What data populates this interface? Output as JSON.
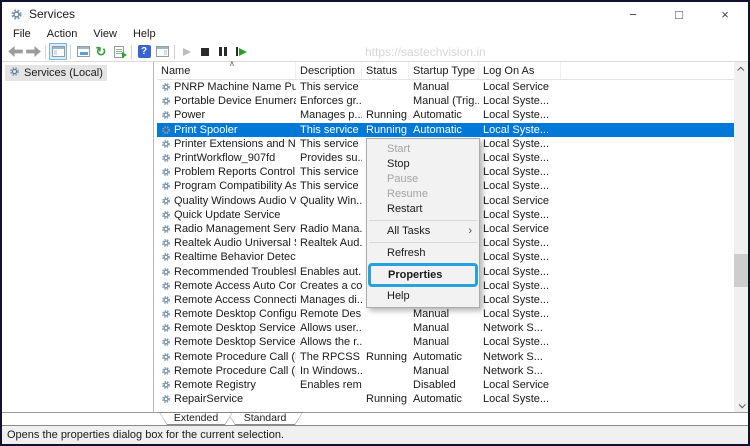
{
  "window": {
    "title": "Services",
    "controls": {
      "minimize": "−",
      "maximize": "□",
      "close": "×"
    }
  },
  "menubar": {
    "items": [
      "File",
      "Action",
      "View",
      "Help"
    ]
  },
  "toolbar": {
    "watermark": "https://sastechvision.in",
    "icons": [
      "back-icon",
      "forward-icon",
      "separator",
      "console-tree-icon",
      "separator",
      "properties-window-icon",
      "refresh-icon",
      "export-list-icon",
      "separator",
      "help-icon",
      "action-pane-icon",
      "separator",
      "start-service-icon",
      "stop-service-icon",
      "pause-service-icon",
      "restart-service-icon"
    ]
  },
  "sidebar": {
    "root_label": "Services (Local)"
  },
  "table": {
    "columns": [
      "Name",
      "Description",
      "Status",
      "Startup Type",
      "Log On As"
    ],
    "rows": [
      {
        "name": "PNRP Machine Name Publi...",
        "description": "This service ...",
        "status": "",
        "startup": "Manual",
        "logon": "Local Service",
        "selected": false
      },
      {
        "name": "Portable Device Enumerator...",
        "description": "Enforces gr...",
        "status": "",
        "startup": "Manual (Trig...",
        "logon": "Local Syste...",
        "selected": false
      },
      {
        "name": "Power",
        "description": "Manages p...",
        "status": "Running",
        "startup": "Automatic",
        "logon": "Local Syste...",
        "selected": false
      },
      {
        "name": "Print Spooler",
        "description": "This service ...",
        "status": "Running",
        "startup": "Automatic",
        "logon": "Local Syste...",
        "selected": true
      },
      {
        "name": "Printer Extensions and Notif...",
        "description": "This service ...",
        "status": "",
        "startup": "",
        "logon": "Local Syste...",
        "selected": false
      },
      {
        "name": "PrintWorkflow_907fd",
        "description": "Provides su...",
        "status": "",
        "startup": "",
        "logon": "Local Syste...",
        "selected": false
      },
      {
        "name": "Problem Reports Control Pa...",
        "description": "This service ...",
        "status": "",
        "startup": "",
        "logon": "Local Syste...",
        "selected": false
      },
      {
        "name": "Program Compatibility Assi...",
        "description": "This service ...",
        "status": "",
        "startup": "",
        "logon": "Local Syste...",
        "selected": false
      },
      {
        "name": "Quality Windows Audio Vid...",
        "description": "Quality Win...",
        "status": "",
        "startup": "",
        "logon": "Local Service",
        "selected": false
      },
      {
        "name": "Quick Update Service",
        "description": "",
        "status": "",
        "startup": "",
        "logon": "Local Syste...",
        "selected": false
      },
      {
        "name": "Radio Management Service",
        "description": "Radio Mana...",
        "status": "",
        "startup": "",
        "logon": "Local Service",
        "selected": false
      },
      {
        "name": "Realtek Audio Universal Ser...",
        "description": "Realtek Aud...",
        "status": "",
        "startup": "",
        "logon": "Local Syste...",
        "selected": false
      },
      {
        "name": "Realtime Behavior Detection",
        "description": "",
        "status": "",
        "startup": "",
        "logon": "Local Syste...",
        "selected": false
      },
      {
        "name": "Recommended Troublesho...",
        "description": "Enables aut...",
        "status": "",
        "startup": "",
        "logon": "Local Syste...",
        "selected": false
      },
      {
        "name": "Remote Access Auto Conne...",
        "description": "Creates a co...",
        "status": "",
        "startup": "",
        "logon": "Local Syste...",
        "selected": false
      },
      {
        "name": "Remote Access Connection...",
        "description": "Manages di...",
        "status": "",
        "startup": "",
        "logon": "Local Syste...",
        "selected": false
      },
      {
        "name": "Remote Desktop Configurat...",
        "description": "Remote Des...",
        "status": "",
        "startup": "Manual",
        "logon": "Local Syste...",
        "selected": false
      },
      {
        "name": "Remote Desktop Services",
        "description": "Allows user...",
        "status": "",
        "startup": "Manual",
        "logon": "Network S...",
        "selected": false
      },
      {
        "name": "Remote Desktop Services U...",
        "description": "Allows the r...",
        "status": "",
        "startup": "Manual",
        "logon": "Local Syste...",
        "selected": false
      },
      {
        "name": "Remote Procedure Call (RPC)",
        "description": "The RPCSS s...",
        "status": "Running",
        "startup": "Automatic",
        "logon": "Network S...",
        "selected": false
      },
      {
        "name": "Remote Procedure Call (RP...",
        "description": "In Windows...",
        "status": "",
        "startup": "Manual",
        "logon": "Network S...",
        "selected": false
      },
      {
        "name": "Remote Registry",
        "description": "Enables rem...",
        "status": "",
        "startup": "Disabled",
        "logon": "Local Service",
        "selected": false
      },
      {
        "name": "RepairService",
        "description": "",
        "status": "Running",
        "startup": "Automatic",
        "logon": "Local Syste...",
        "selected": false
      }
    ]
  },
  "context_menu": {
    "items": [
      {
        "label": "Start",
        "state": "disabled"
      },
      {
        "label": "Stop",
        "state": "normal"
      },
      {
        "label": "Pause",
        "state": "disabled"
      },
      {
        "label": "Resume",
        "state": "disabled"
      },
      {
        "label": "Restart",
        "state": "normal"
      },
      {
        "type": "separator"
      },
      {
        "label": "All Tasks",
        "state": "normal",
        "submenu": true
      },
      {
        "type": "separator"
      },
      {
        "label": "Refresh",
        "state": "normal"
      },
      {
        "label": "Properties",
        "state": "highlighted"
      },
      {
        "label": "Help",
        "state": "normal"
      }
    ]
  },
  "tabs": {
    "extended": "Extended",
    "standard": "Standard"
  },
  "statusbar": {
    "text": "Opens the properties dialog box for the current selection."
  }
}
